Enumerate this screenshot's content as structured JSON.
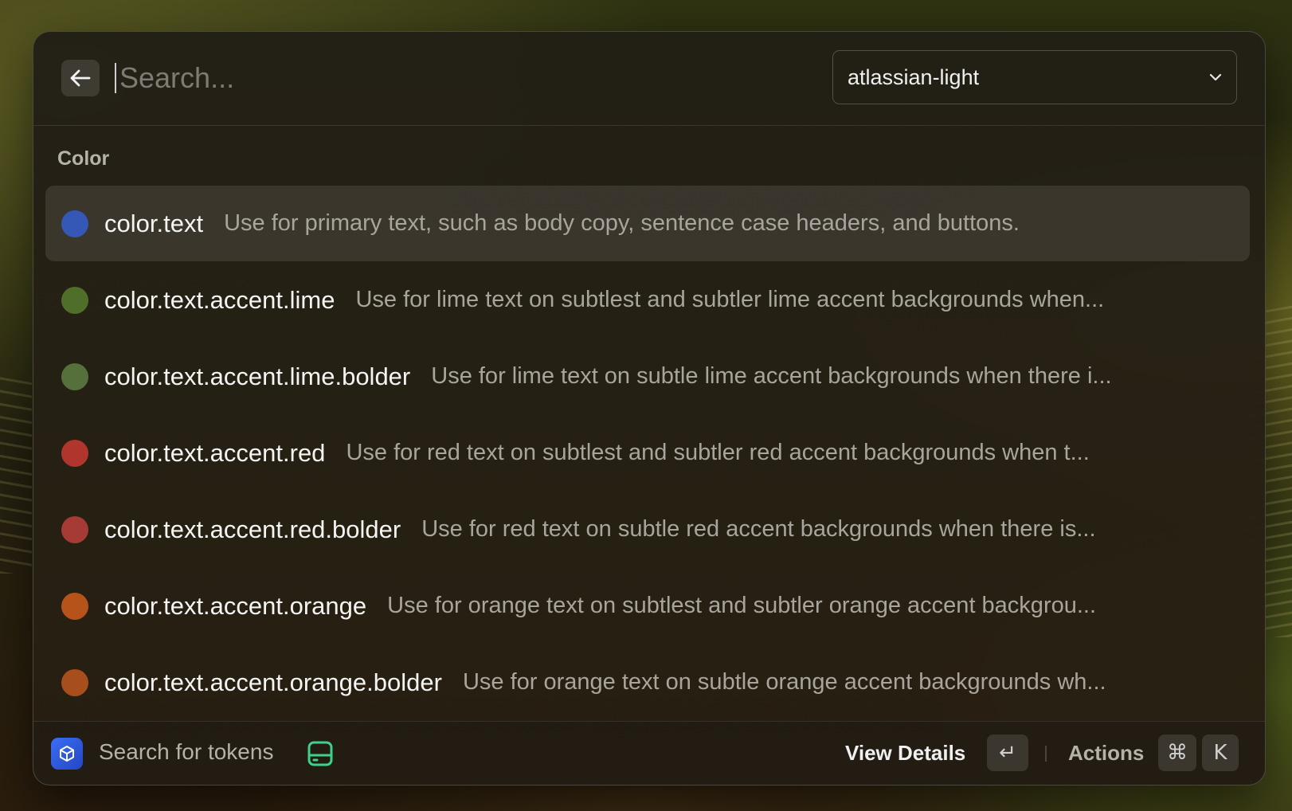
{
  "header": {
    "search_placeholder": "Search...",
    "search_value": "",
    "theme_selected": "atlassian-light"
  },
  "section": {
    "title": "Color"
  },
  "tokens": [
    {
      "name": "color.text",
      "description": "Use for primary text, such as body copy, sentence case headers, and buttons.",
      "color": "#3557b5",
      "selected": true
    },
    {
      "name": "color.text.accent.lime",
      "description": "Use for lime text on subtlest and subtler lime accent backgrounds when...",
      "color": "#4f6e2a",
      "selected": false
    },
    {
      "name": "color.text.accent.lime.bolder",
      "description": "Use for lime text on subtle lime accent backgrounds when there i...",
      "color": "#55703a",
      "selected": false
    },
    {
      "name": "color.text.accent.red",
      "description": "Use for red text on subtlest and subtler red accent backgrounds when t...",
      "color": "#b0352c",
      "selected": false
    },
    {
      "name": "color.text.accent.red.bolder",
      "description": "Use for red text on subtle red accent backgrounds when there is...",
      "color": "#a63a34",
      "selected": false
    },
    {
      "name": "color.text.accent.orange",
      "description": "Use for orange text on subtlest and subtler orange accent backgrou...",
      "color": "#b5531a",
      "selected": false
    },
    {
      "name": "color.text.accent.orange.bolder",
      "description": "Use for orange text on subtle orange accent backgrounds wh...",
      "color": "#a84d1c",
      "selected": false
    }
  ],
  "footer": {
    "title": "Search for tokens",
    "primary_action": "View Details",
    "enter_key": "↵",
    "actions_label": "Actions",
    "cmd_key": "⌘",
    "k_key": "K"
  },
  "icons": {
    "back": "arrow-left-icon",
    "dropdown": "chevron-down-icon",
    "app": "cube-icon",
    "extension": "drive-icon"
  }
}
